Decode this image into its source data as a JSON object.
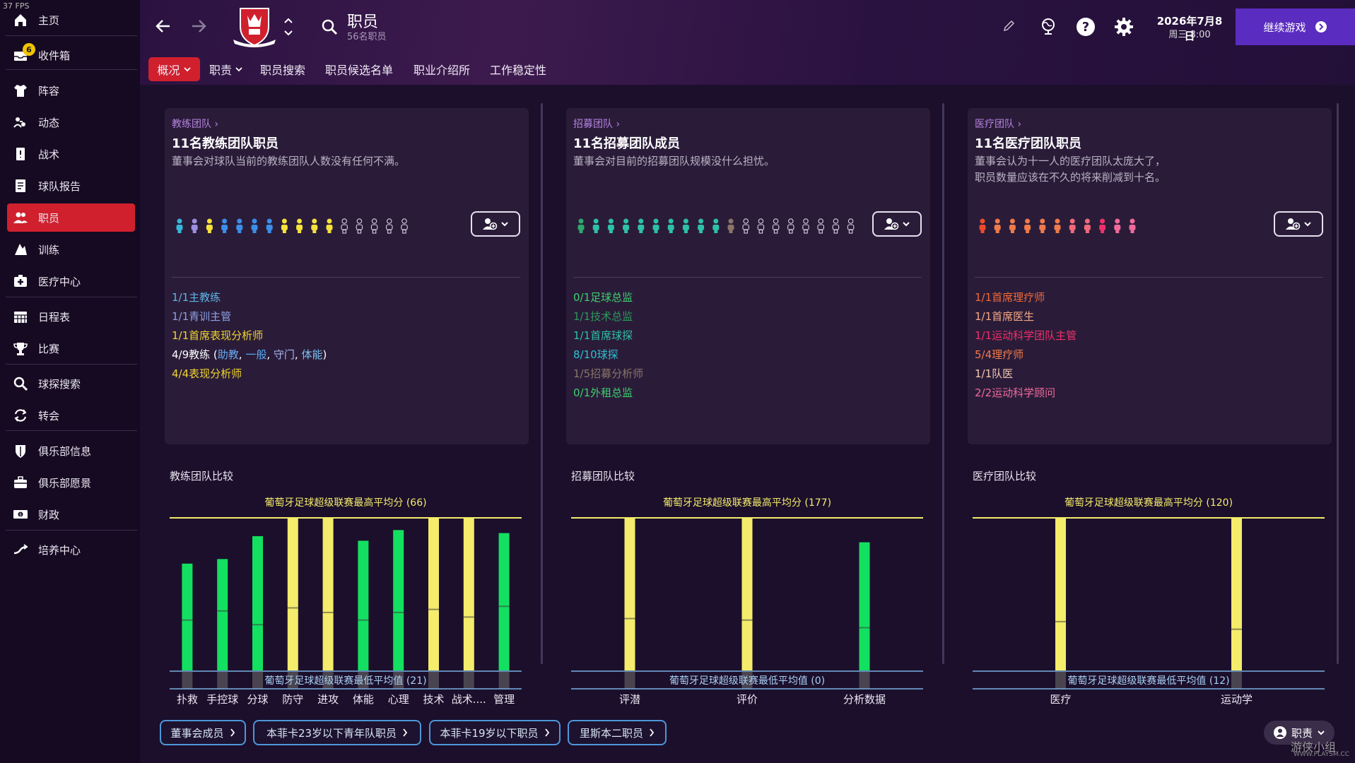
{
  "fps": "37 FPS",
  "sidebar": {
    "items": [
      {
        "label": "主页",
        "icon": "home-icon"
      },
      {
        "label": "收件箱",
        "icon": "inbox-icon",
        "badge": "6"
      },
      {
        "label": "阵容",
        "icon": "shirt-icon"
      },
      {
        "label": "动态",
        "icon": "dynamics-icon"
      },
      {
        "label": "战术",
        "icon": "tactics-icon"
      },
      {
        "label": "球队报告",
        "icon": "report-icon"
      },
      {
        "label": "职员",
        "icon": "staff-icon",
        "active": true
      },
      {
        "label": "训练",
        "icon": "training-icon"
      },
      {
        "label": "医疗中心",
        "icon": "medical-icon"
      },
      {
        "label": "日程表",
        "icon": "calendar-icon"
      },
      {
        "label": "比赛",
        "icon": "trophy-icon"
      },
      {
        "label": "球探搜索",
        "icon": "scout-search-icon"
      },
      {
        "label": "转会",
        "icon": "transfer-icon"
      },
      {
        "label": "俱乐部信息",
        "icon": "club-shield-icon"
      },
      {
        "label": "俱乐部愿景",
        "icon": "vision-icon"
      },
      {
        "label": "财政",
        "icon": "finance-icon"
      },
      {
        "label": "培养中心",
        "icon": "development-icon"
      }
    ]
  },
  "header": {
    "title": "职员",
    "subtitle": "56名职员",
    "date": "2026年7月8日",
    "weekday_time": "周三 8:00",
    "continue_label": "继续游戏"
  },
  "tabs": [
    {
      "label": "概况"
    },
    {
      "label": "职责"
    },
    {
      "label": "职员搜索"
    },
    {
      "label": "职员候选名单"
    },
    {
      "label": "职业介绍所"
    },
    {
      "label": "工作稳定性"
    }
  ],
  "panels": [
    {
      "crumb": "教练团队",
      "title": "11名教练团队职员",
      "desc": "董事会对球队当前的教练团队人数没有任何不满。",
      "people_colors": [
        "#36b7d8",
        "#9b8fe0",
        "#f5e23a",
        "#3b8fe8",
        "#3b8fe8",
        "#3b8fe8",
        "#3b8fe8",
        "#f5e23a",
        "#f5e23a",
        "#f5e23a",
        "#f5e23a"
      ],
      "empty_slots": 5,
      "roles": [
        {
          "text": "1/1主教练",
          "color": "#5fb4e8"
        },
        {
          "text": "1/1青训主管",
          "color": "#8f9fe0"
        },
        {
          "text": "1/1首席表现分析师",
          "color": "#f0d430"
        },
        {
          "text": "4/9教练 (",
          "color": "#ffffff"
        },
        {
          "text": "4/4表现分析师",
          "color": "#f0d430"
        }
      ],
      "coach_sub": {
        "a": "助教",
        "b": "一般",
        "c": "守门",
        "d": "体能",
        "sep": ", ",
        "close": ")"
      }
    },
    {
      "crumb": "招募团队",
      "title": "11名招募团队成员",
      "desc": "董事会对目前的招募团队规模没什么担忧。",
      "people_colors": [
        "#2ea86a",
        "#2ec0a8",
        "#2ec0a8",
        "#2ec0a8",
        "#2ec0a8",
        "#2ec0a8",
        "#2ec0a8",
        "#2ec0a8",
        "#2ec0a8",
        "#2ec0a8",
        "#8a7568"
      ],
      "empty_slots": 8,
      "roles": [
        {
          "text": "0/1足球总监",
          "color": "#3fcf6f"
        },
        {
          "text": "1/1技术总监",
          "color": "#2a9a5a"
        },
        {
          "text": "1/1首席球探",
          "color": "#2ec0a8"
        },
        {
          "text": "8/10球探",
          "color": "#2ec0d0"
        },
        {
          "text": "1/5招募分析师",
          "color": "#8a7568"
        },
        {
          "text": "0/1外租总监",
          "color": "#3fcf6f"
        }
      ]
    },
    {
      "crumb": "医疗团队",
      "title": "11名医疗团队职员",
      "desc": "董事会认为十一人的医疗团队太庞大了，\n职员数量应该在不久的将来削减到十名。",
      "people_colors": [
        "#f04a2a",
        "#f07a4a",
        "#f07a4a",
        "#f07a4a",
        "#f07a4a",
        "#f07a4a",
        "#f06a7a",
        "#f06a7a",
        "#f0306a",
        "#f06a9a",
        "#f06a9a"
      ],
      "empty_slots": 0,
      "roles": [
        {
          "text": "1/1首席理疗师",
          "color": "#f06a3a"
        },
        {
          "text": "1/1首席医生",
          "color": "#f4a884"
        },
        {
          "text": "1/1运动科学团队主管",
          "color": "#f0306a"
        },
        {
          "text": "5/4理疗师",
          "color": "#f07a4a"
        },
        {
          "text": "1/1队医",
          "color": "#f4c8b0"
        },
        {
          "text": "2/2运动科学顾问",
          "color": "#f06a9a"
        }
      ]
    }
  ],
  "chart_data": [
    {
      "type": "bar",
      "title": "教练团队比较",
      "top_label": "葡萄牙足球超级联赛最高平均分 (66)",
      "bottom_label": "葡萄牙足球超级联赛最低平均值 (21)",
      "categories": [
        "扑救",
        "手控球",
        "分球",
        "防守",
        "进攻",
        "体能",
        "心理",
        "技术",
        "战术....",
        "管理"
      ],
      "values": [
        0.7,
        0.73,
        0.88,
        1.0,
        1.0,
        0.85,
        0.92,
        1.0,
        1.0,
        0.9
      ],
      "avg_marks": [
        0.33,
        0.39,
        0.3,
        0.41,
        0.38,
        0.33,
        0.38,
        0.4,
        0.35,
        0.42
      ],
      "colors": [
        "#13e060",
        "#13e060",
        "#13e060",
        "#f4ec6a",
        "#f4ec6a",
        "#13e060",
        "#13e060",
        "#f4ec6a",
        "#f4ec6a",
        "#13e060"
      ],
      "ylim": [
        0,
        1
      ]
    },
    {
      "type": "bar",
      "title": "招募团队比较",
      "top_label": "葡萄牙足球超级联赛最高平均分 (177)",
      "bottom_label": "葡萄牙足球超级联赛最低平均值 (0)",
      "categories": [
        "评潜",
        "评价",
        "分析数据"
      ],
      "values": [
        1.0,
        1.0,
        0.84
      ],
      "avg_marks": [
        0.34,
        0.33,
        0.28
      ],
      "colors": [
        "#f4ec6a",
        "#f4ec6a",
        "#13e060"
      ],
      "ylim": [
        0,
        1
      ]
    },
    {
      "type": "bar",
      "title": "医疗团队比较",
      "top_label": "葡萄牙足球超级联赛最高平均分 (120)",
      "bottom_label": "葡萄牙足球超级联赛最低平均值 (12)",
      "categories": [
        "医疗",
        "运动学"
      ],
      "values": [
        1.0,
        1.0
      ],
      "avg_marks": [
        0.32,
        0.27
      ],
      "colors": [
        "#f4ec6a",
        "#f4ec6a"
      ],
      "ylim": [
        0,
        1
      ]
    }
  ],
  "bottom_links": [
    {
      "label": "董事会成员"
    },
    {
      "label": "本菲卡23岁以下青年队职员"
    },
    {
      "label": "本菲卡19岁以下职员"
    },
    {
      "label": "里斯本二职员"
    }
  ],
  "role_menu_label": "职责",
  "watermark": "游侠小组",
  "watermark_url": "WWW.PLAYSM.CC"
}
